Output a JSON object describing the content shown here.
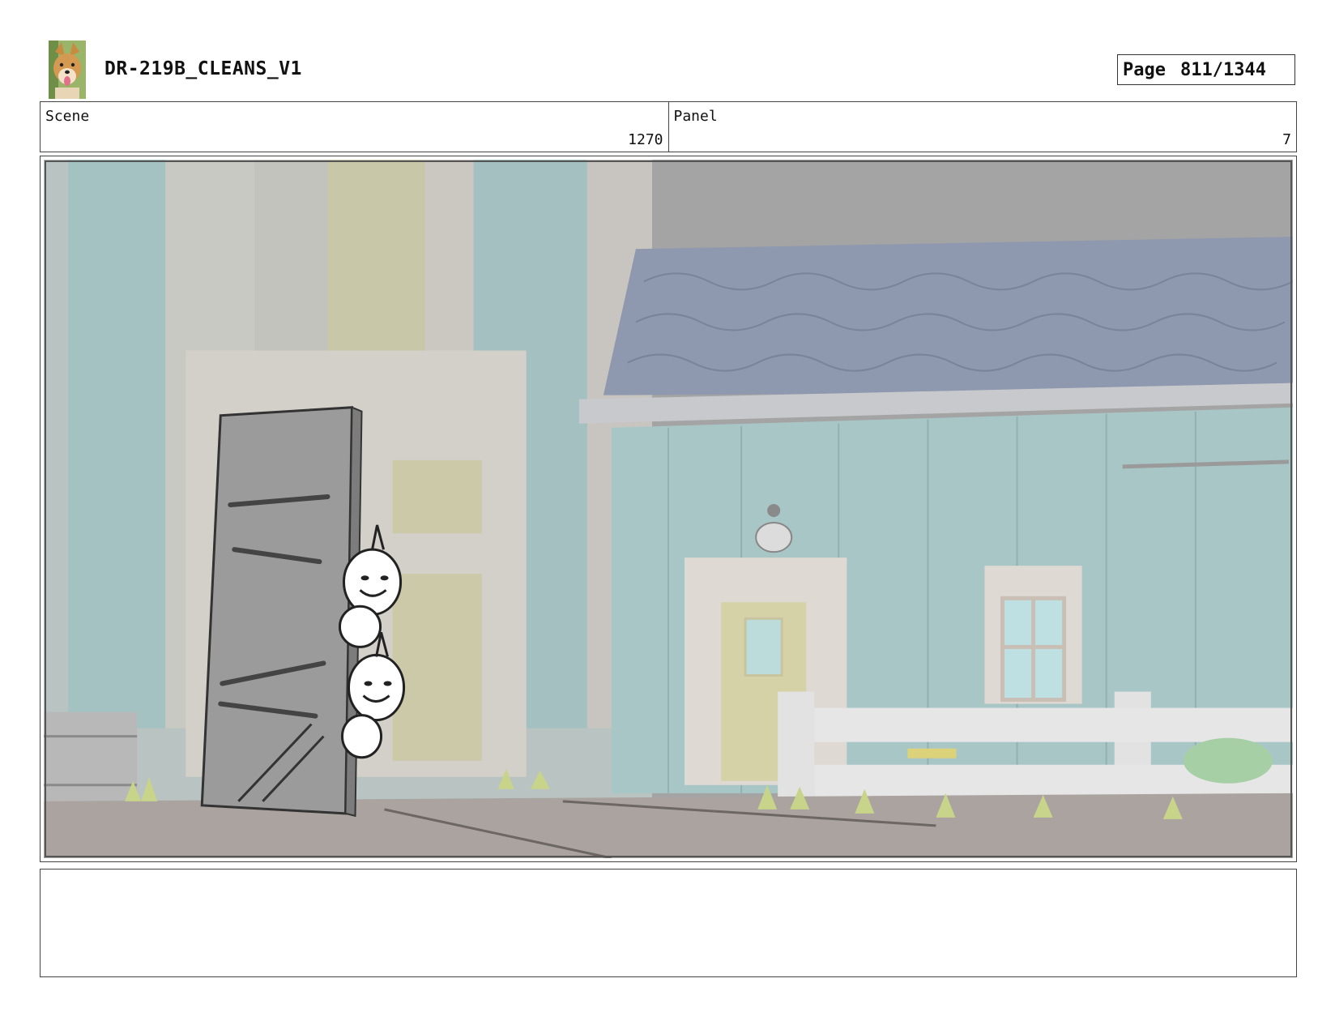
{
  "header": {
    "title": "DR-219B_CLEANS_V1",
    "page_label": "Page",
    "page_value": "811/1344"
  },
  "info": {
    "scene_label": "Scene",
    "scene_value": "1270",
    "panel_label": "Panel",
    "panel_value": "7"
  },
  "notes": {
    "text": ""
  },
  "colors": {
    "sky": "#a4a4a4",
    "wall_teal": "#a9c6c6",
    "roof_blue": "#8e98ae",
    "door_grey": "#9b9b9b",
    "ground": "#aaa39f",
    "grass": "#c7d48a"
  }
}
